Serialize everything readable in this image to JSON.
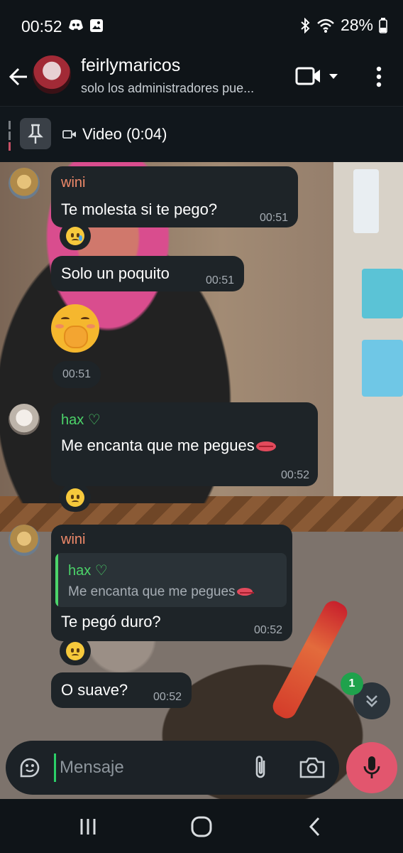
{
  "status_bar": {
    "time": "00:52",
    "battery": "28%",
    "icons": [
      "discord-icon",
      "gallery-icon",
      "bluetooth-icon",
      "wifi-icon",
      "battery-icon"
    ]
  },
  "header": {
    "title": "feirlymaricos",
    "subtitle": "solo los administradores pue..."
  },
  "pinned": {
    "label": "Video (0:04)"
  },
  "messages": [
    {
      "sender": "wini",
      "text": "Te molesta si te pego?",
      "time": "00:51",
      "reaction": "crying-face"
    },
    {
      "text": "Solo un poquito",
      "time": "00:51"
    },
    {
      "emoji": "face-with-hand-over-mouth",
      "time": "00:51"
    },
    {
      "sender": "hax ♡",
      "text": "Me encanta que me pegues",
      "time": "00:52",
      "reaction": "frowning-face"
    },
    {
      "sender": "wini",
      "reply_to": {
        "sender": "hax ♡",
        "text": "Me encanta que me pegues"
      },
      "text": "Te pegó duro?",
      "time": "00:52",
      "reaction": "worried-face"
    },
    {
      "text": "O suave?",
      "time": "00:52"
    }
  ],
  "scroll": {
    "unread_count": "1"
  },
  "input": {
    "placeholder": "Mensaje"
  },
  "colors": {
    "wini_name": "#f08a6a",
    "hax_name": "#4cd46a",
    "bubble": "#1e2428",
    "mic_button": "#e2566e",
    "badge": "#1fa24c"
  }
}
